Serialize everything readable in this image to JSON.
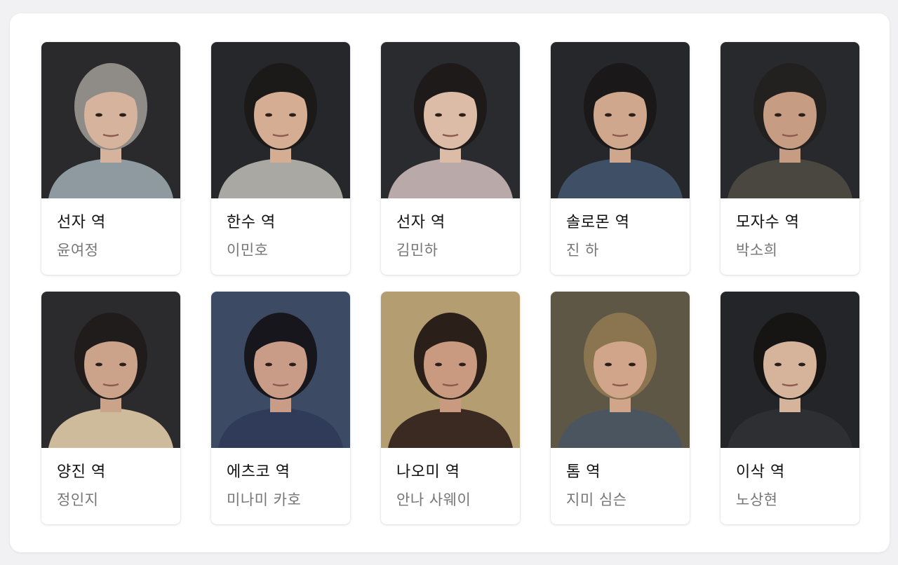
{
  "cast": [
    {
      "role": "선자 역",
      "actor": "윤여정",
      "bg": "#2a2a2c",
      "skin": "#d6b39c",
      "hair": "#8f8c88",
      "cloth": "#8f9aa0"
    },
    {
      "role": "한수 역",
      "actor": "이민호",
      "bg": "#26272a",
      "skin": "#d4ad92",
      "hair": "#1c1a19",
      "cloth": "#a9a8a2"
    },
    {
      "role": "선자 역",
      "actor": "김민하",
      "bg": "#2a2b2e",
      "skin": "#dcbca6",
      "hair": "#1d1a19",
      "cloth": "#b9a9a8"
    },
    {
      "role": "솔로몬 역",
      "actor": "진 하",
      "bg": "#25272b",
      "skin": "#cfa78c",
      "hair": "#1a1818",
      "cloth": "#3f4f66"
    },
    {
      "role": "모자수 역",
      "actor": "박소희",
      "bg": "#28292c",
      "skin": "#c69d82",
      "hair": "#232120",
      "cloth": "#4a4740"
    },
    {
      "role": "양진 역",
      "actor": "정인지",
      "bg": "#2b2b2d",
      "skin": "#caa38a",
      "hair": "#1f1c1b",
      "cloth": "#cdbb9c"
    },
    {
      "role": "에츠코 역",
      "actor": "미나미 카호",
      "bg": "#3c4a63",
      "skin": "#c99c88",
      "hair": "#16161c",
      "cloth": "#2f3b58"
    },
    {
      "role": "나오미 역",
      "actor": "안나 사웨이",
      "bg": "#b59d72",
      "skin": "#c99a7f",
      "hair": "#2a1f19",
      "cloth": "#3a2a22"
    },
    {
      "role": "톰 역",
      "actor": "지미 심슨",
      "bg": "#5e5746",
      "skin": "#d1a58a",
      "hair": "#8a7550",
      "cloth": "#4b5560"
    },
    {
      "role": "이삭 역",
      "actor": "노상현",
      "bg": "#242529",
      "skin": "#d6b49c",
      "hair": "#161514",
      "cloth": "#2e2f33"
    }
  ]
}
